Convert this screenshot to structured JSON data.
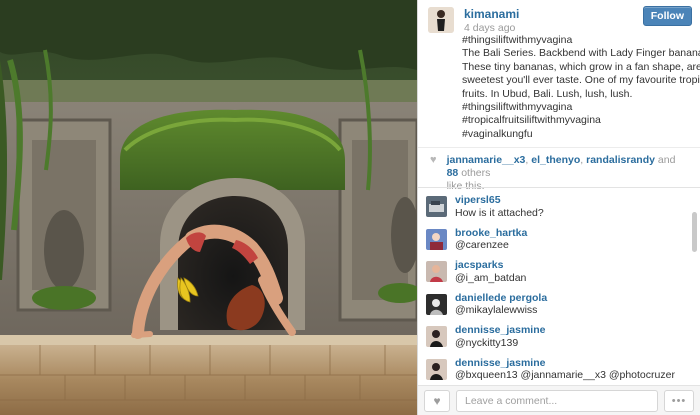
{
  "post": {
    "username": "kimanami",
    "time": "4 days ago",
    "follow_label": "Follow",
    "caption_lines": [
      "#thingsiliftwithmyvagina",
      "The Bali Series. Backbend with Lady Finger bananas.",
      "These tiny bananas, which grow in a fan shape, are the",
      "sweetest you'll ever taste. One of my favourite tropical",
      "fruits. In Ubud, Bali. Lush, lush, lush.",
      "#thingsiliftwithmyvagina",
      "#tropicalfruitsiliftwithmyvagina",
      "#vaginalkungfu"
    ]
  },
  "likes": {
    "users": [
      "jannamarie__x3",
      "el_thenyo",
      "randalisrandy"
    ],
    "sep1": ", ",
    "sep2": ", ",
    "and": " and ",
    "others_count": "88",
    "others_suffix": " others",
    "tail": "like this."
  },
  "comments": [
    {
      "user": "vipersl65",
      "text": "How is it attached?"
    },
    {
      "user": "brooke_hartka",
      "text": "@carenzee"
    },
    {
      "user": "jacsparks",
      "text": "@i_am_batdan"
    },
    {
      "user": "daniellede pergola",
      "text": "@mikaylalewwiss"
    },
    {
      "user": "dennisse_jasmine",
      "text": "@nyckitty139"
    },
    {
      "user": "dennisse_jasmine",
      "text": "@bxqueen13 @jannamarie__x3 @photocruzer"
    }
  ],
  "footer": {
    "comment_placeholder": "Leave a comment...",
    "more_label": "•••",
    "like_icon": "heart-icon"
  },
  "icons": {
    "likes_heart": "♥",
    "like_button": "♥"
  },
  "colors": {
    "link": "#2b6d9e",
    "follow_button": "#4b84b8",
    "muted": "#9a9a9a"
  }
}
